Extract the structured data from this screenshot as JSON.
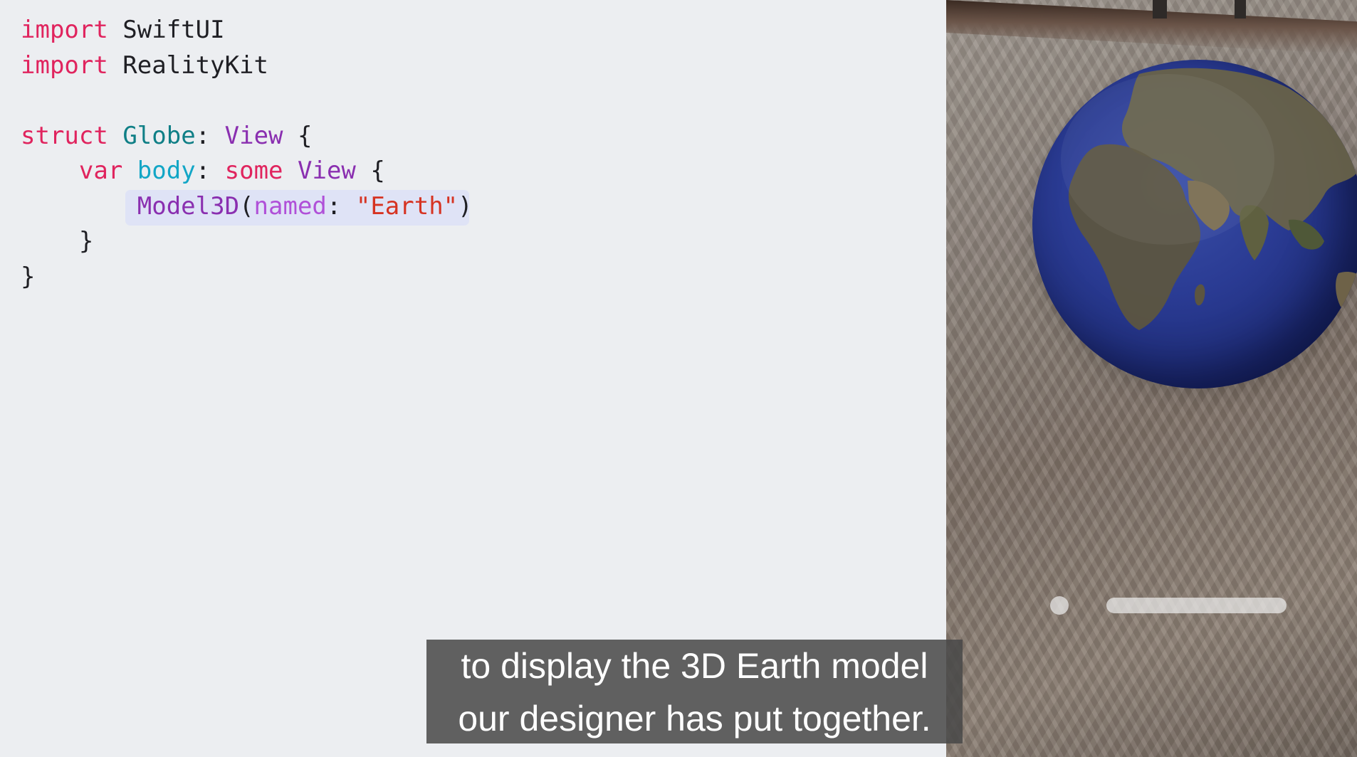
{
  "code": {
    "lines": [
      [
        {
          "t": "import",
          "c": "kw"
        },
        {
          "t": " SwiftUI",
          "c": "plain"
        }
      ],
      [
        {
          "t": "import",
          "c": "kw"
        },
        {
          "t": " RealityKit",
          "c": "plain"
        }
      ],
      [],
      [
        {
          "t": "struct",
          "c": "kw"
        },
        {
          "t": " ",
          "c": "plain"
        },
        {
          "t": "Globe",
          "c": "type"
        },
        {
          "t": ": ",
          "c": "plain"
        },
        {
          "t": "View",
          "c": "typ2"
        },
        {
          "t": " {",
          "c": "plain"
        }
      ],
      [
        {
          "t": "    ",
          "c": "plain"
        },
        {
          "t": "var",
          "c": "kw"
        },
        {
          "t": " ",
          "c": "plain"
        },
        {
          "t": "body",
          "c": "prop"
        },
        {
          "t": ": ",
          "c": "plain"
        },
        {
          "t": "some",
          "c": "kw"
        },
        {
          "t": " ",
          "c": "plain"
        },
        {
          "t": "View",
          "c": "typ2"
        },
        {
          "t": " {",
          "c": "plain"
        }
      ],
      [
        {
          "t": "        ",
          "c": "plain"
        },
        {
          "t": "Model3D",
          "c": "typ2"
        },
        {
          "t": "(",
          "c": "plain"
        },
        {
          "t": "named",
          "c": "param"
        },
        {
          "t": ": ",
          "c": "plain"
        },
        {
          "t": "\"Earth\"",
          "c": "str"
        },
        {
          "t": ")",
          "c": "plain"
        }
      ],
      [
        {
          "t": "    }",
          "c": "plain"
        }
      ],
      [
        {
          "t": "}",
          "c": "plain"
        }
      ]
    ]
  },
  "subtitle": {
    "line1": "to display the 3D Earth model",
    "line2": "our designer has put together."
  },
  "colors": {
    "keyword": "#e0245e",
    "type_name": "#0f7f86",
    "type_ref": "#8a2fb0",
    "property": "#12a6c6",
    "parameter": "#b050d8",
    "string": "#d63322",
    "highlight": "#dfe3f6",
    "background": "#eceef1"
  }
}
